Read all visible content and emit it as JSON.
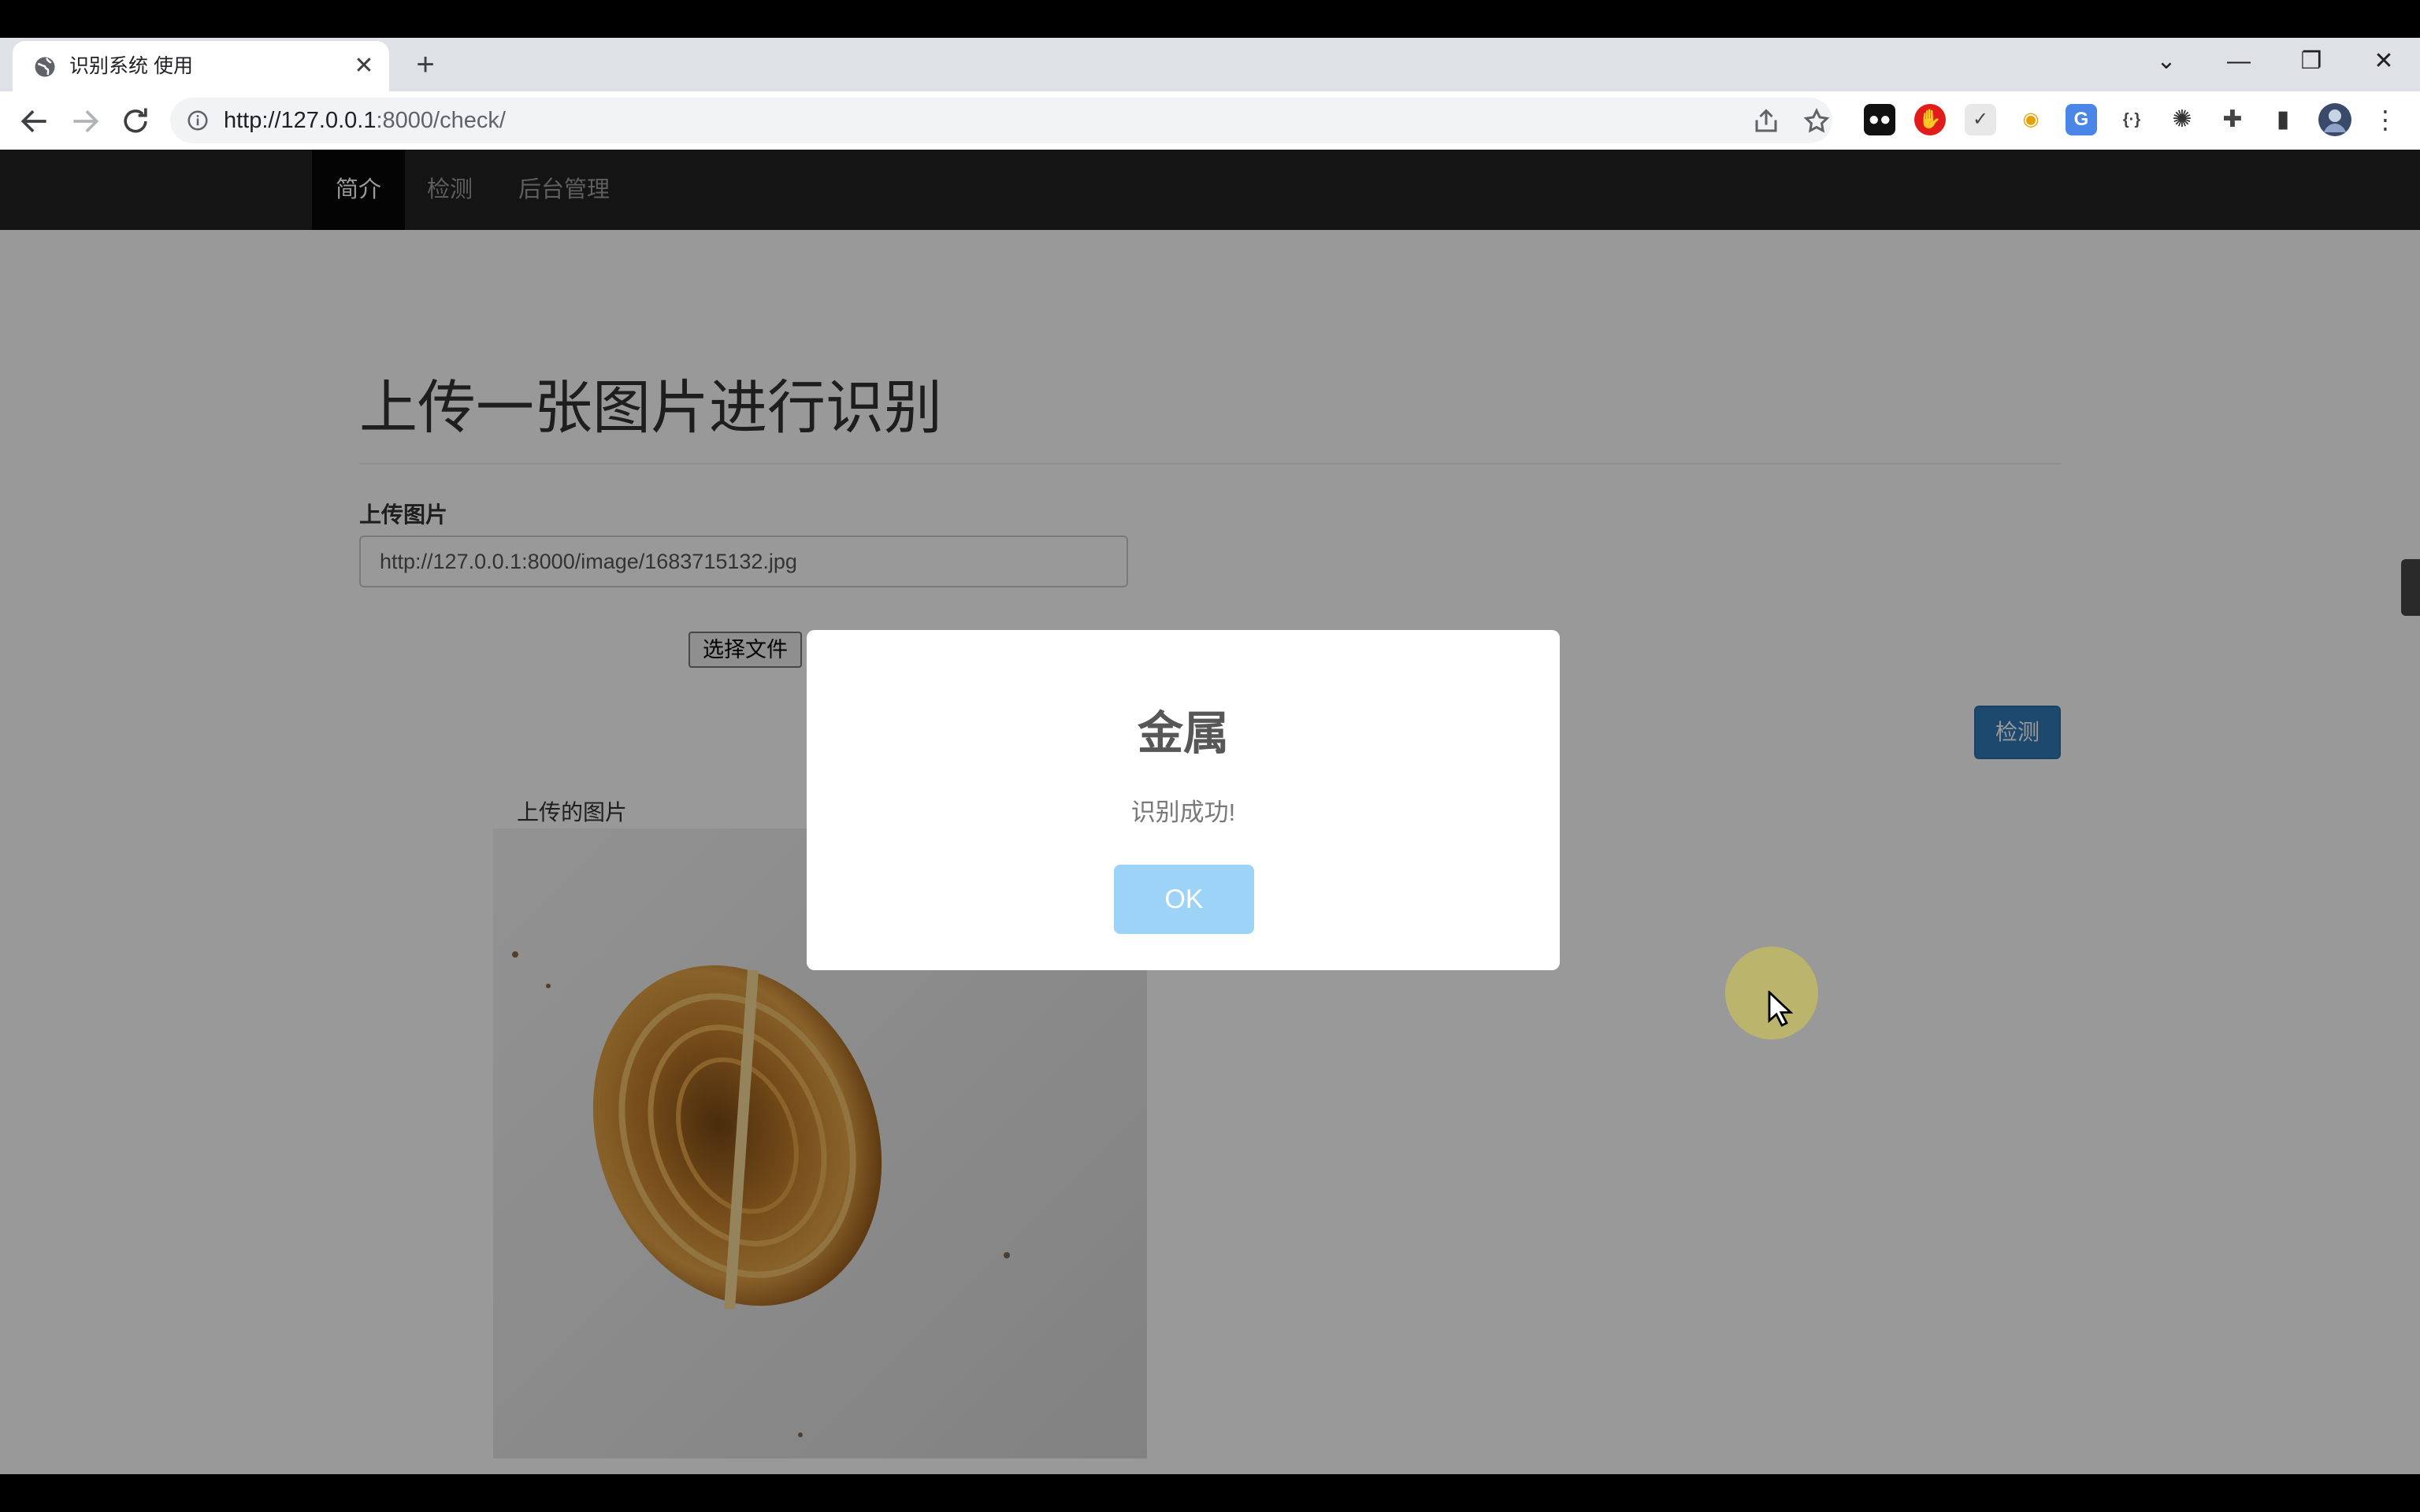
{
  "browser": {
    "tab_title": "识别系统 使用",
    "new_tab_symbol": "+",
    "tab_close_symbol": "✕",
    "url_host": "http://127.0.0.1",
    "url_rest": ":8000/check/",
    "window_controls": {
      "minimize": "—",
      "restore": "❐",
      "close": "✕",
      "tab_search": "⌄"
    },
    "extensions": [
      {
        "name": "tampermonkey-icon",
        "glyph": "●●"
      },
      {
        "name": "adblock-icon",
        "glyph": "✋"
      },
      {
        "name": "checkmark-extension-icon",
        "glyph": "✓"
      },
      {
        "name": "chrome-color-icon",
        "glyph": "◉"
      },
      {
        "name": "google-translate-icon",
        "glyph": "G"
      },
      {
        "name": "code-extension-icon",
        "glyph": "{·}"
      },
      {
        "name": "openai-icon",
        "glyph": "✺"
      },
      {
        "name": "extensions-puzzle-icon",
        "glyph": "✚"
      },
      {
        "name": "side-panel-icon",
        "glyph": "▮"
      }
    ]
  },
  "navbar": {
    "items": [
      {
        "label": "简介",
        "active": true
      },
      {
        "label": "检测",
        "active": false
      },
      {
        "label": "后台管理",
        "active": false
      }
    ]
  },
  "main": {
    "heading": "上传一张图片进行识别",
    "upload_label": "上传图片",
    "upload_value": "http://127.0.0.1:8000/image/1683715132.jpg",
    "file_button": "选择文件",
    "detect_button": "检测",
    "uploaded_caption": "上传的图片"
  },
  "modal": {
    "title": "金属",
    "text": "识别成功!",
    "ok_label": "OK"
  },
  "colors": {
    "ok_button": "#9cd3f7",
    "detect_button": "#337ab7",
    "navbar": "#222222",
    "cursor_halo": "#c6be5f"
  }
}
